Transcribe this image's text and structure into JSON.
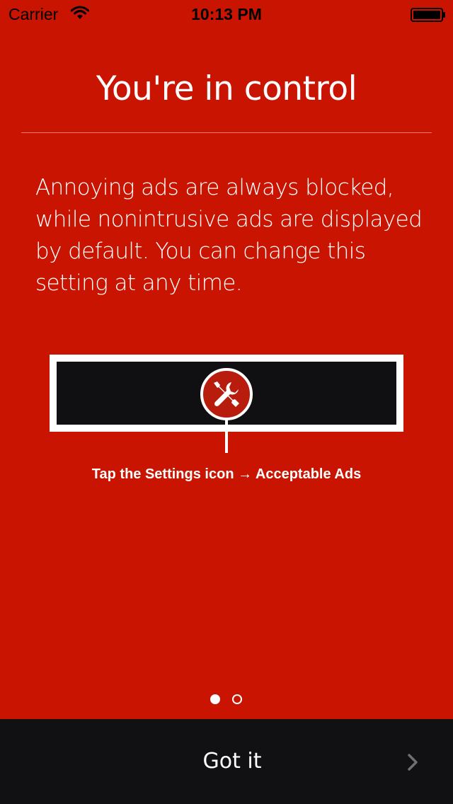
{
  "status_bar": {
    "carrier": "Carrier",
    "time": "10:13 PM",
    "wifi_icon": "wifi-icon",
    "battery_icon": "battery-icon"
  },
  "screen": {
    "title": "You're in control",
    "body": "Annoying ads are always blocked, while nonintrusive ads are displayed by default. You can change this setting at any time.",
    "hint": "Tap the Settings icon → Acceptable Ads",
    "settings_icon": "wrench-screwdriver-icon"
  },
  "pager": {
    "pages": 2,
    "current": 1
  },
  "footer": {
    "button_label": "Got it",
    "chevron_icon": "chevron-right-icon"
  },
  "colors": {
    "background": "#c81400",
    "footer": "#111113",
    "toolbar": "#101012",
    "badge": "#b71c0c",
    "text": "#ffffff"
  }
}
